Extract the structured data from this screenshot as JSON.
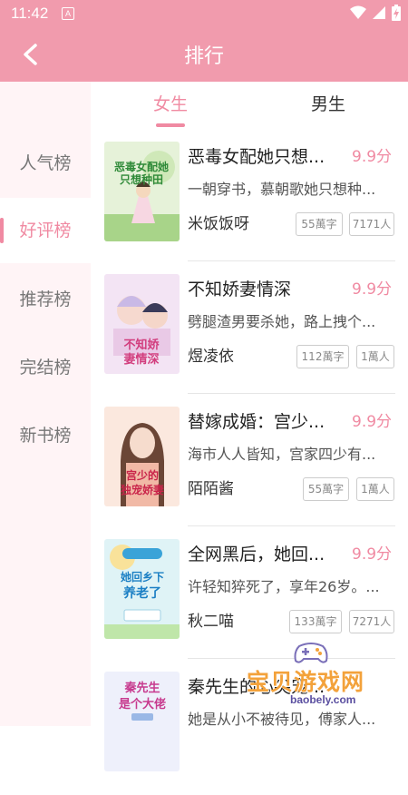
{
  "status_bar": {
    "time": "11:42",
    "notif_letter": "A"
  },
  "header": {
    "title": "排行"
  },
  "sidebar": {
    "items": [
      {
        "label": "人气榜",
        "active": false
      },
      {
        "label": "好评榜",
        "active": true
      },
      {
        "label": "推荐榜",
        "active": false
      },
      {
        "label": "完结榜",
        "active": false
      },
      {
        "label": "新书榜",
        "active": false
      }
    ]
  },
  "tabs": [
    {
      "label": "女生",
      "active": true
    },
    {
      "label": "男生",
      "active": false
    }
  ],
  "books": [
    {
      "title": "恶毒女配她只想...",
      "score": "9.9分",
      "desc": "一朝穿书，慕朝歌她只想种...",
      "author": "米饭饭呀",
      "words": "55萬字",
      "readers": "7171人",
      "cover_text": "恶毒女配她只想种田"
    },
    {
      "title": "不知娇妻情深",
      "score": "9.9分",
      "desc": "劈腿渣男要杀她，路上拽个...",
      "author": "煜凌依",
      "words": "112萬字",
      "readers": "1萬人",
      "cover_text": "不知娇妻情深"
    },
    {
      "title": "替嫁成婚：宫少...",
      "score": "9.9分",
      "desc": "海市人人皆知，宫家四少有...",
      "author": "陌陌酱",
      "words": "55萬字",
      "readers": "1萬人",
      "cover_text": "宫少的独宠娇妻"
    },
    {
      "title": "全网黑后，她回...",
      "score": "9.9分",
      "desc": "许轻知猝死了，享年26岁。...",
      "author": "秋二喵",
      "words": "133萬字",
      "readers": "7271人",
      "cover_text": "她回乡下养老了"
    },
    {
      "title": "秦先生的心尖宠...",
      "score": "",
      "desc": "她是从小不被待见，傅家人...",
      "author": "",
      "words": "",
      "readers": "",
      "cover_text": "秦先生是个大佬"
    }
  ],
  "watermark": {
    "text": "宝贝游戏网",
    "url": "baobely.com"
  },
  "colors": {
    "accent": "#f19bad",
    "accent_text": "#f08aa2",
    "sidebar_bg": "#fff4f6"
  }
}
